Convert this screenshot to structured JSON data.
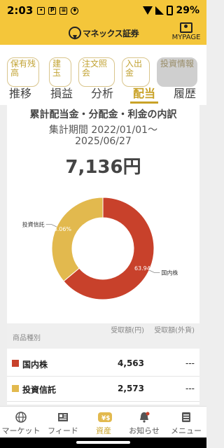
{
  "status_bar": {
    "time": "2:03",
    "battery": "29%"
  },
  "header": {
    "logo_text": "マネックス証券",
    "mypage_label": "MYPAGE"
  },
  "subtabs": [
    {
      "label": "保有残高"
    },
    {
      "label": "建玉"
    },
    {
      "label": "注文照会"
    },
    {
      "label": "入出金"
    },
    {
      "label": "投資情報"
    }
  ],
  "main_tabs": [
    {
      "label": "推移"
    },
    {
      "label": "損益"
    },
    {
      "label": "分析"
    },
    {
      "label": "配当"
    },
    {
      "label": "履歴"
    }
  ],
  "card": {
    "title": "累計配当金・分配金・利金の内訳",
    "period_line1": "集計期間 2022/01/01〜",
    "period_line2": "2025/06/27",
    "total": "7,136円"
  },
  "chart_data": {
    "type": "pie",
    "style": "donut",
    "categories": [
      "国内株",
      "投資信託"
    ],
    "values": [
      63.94,
      36.06
    ],
    "value_labels": [
      "63.94%",
      "36.06%"
    ],
    "colors": [
      "#c8412b",
      "#e2b94e"
    ]
  },
  "table": {
    "headers": {
      "type": "商品種別",
      "received_jpy": "受取額(円)",
      "received_fx": "受取額(外貨)"
    },
    "rows": [
      {
        "name": "国内株",
        "amount": "4,563",
        "fx": "---",
        "color": "#c8412b"
      },
      {
        "name": "投資信託",
        "amount": "2,573",
        "fx": "---",
        "color": "#e2b94e"
      }
    ]
  },
  "bottom_nav": [
    {
      "label": "マーケット",
      "icon": "globe-icon"
    },
    {
      "label": "フィード",
      "icon": "newspaper-icon"
    },
    {
      "label": "資産",
      "icon": "yen-coins-icon"
    },
    {
      "label": "お知らせ",
      "icon": "bell-icon"
    },
    {
      "label": "メニュー",
      "icon": "menu-icon"
    }
  ]
}
